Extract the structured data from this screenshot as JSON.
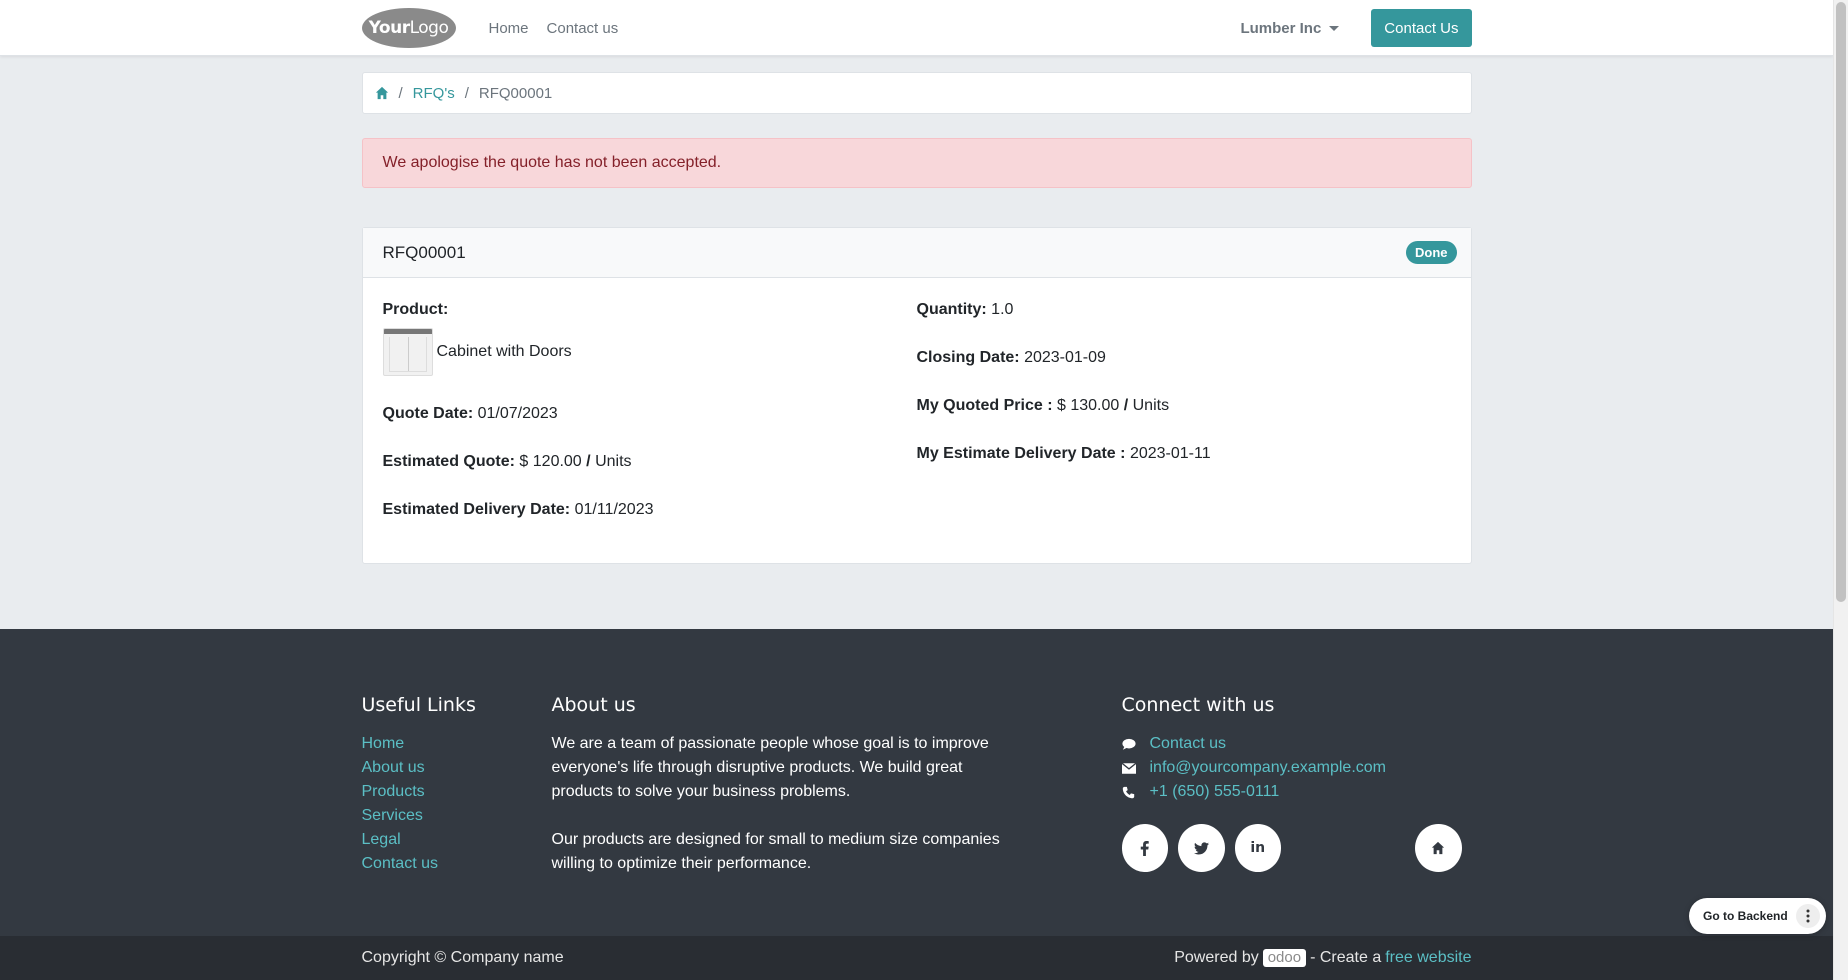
{
  "header": {
    "logo_text_bold": "Your",
    "logo_text": "Logo",
    "nav": [
      "Home",
      "Contact us"
    ],
    "company": "Lumber Inc",
    "contact_button": "Contact Us"
  },
  "breadcrumb": {
    "home_icon": "home-icon",
    "link": "RFQ's",
    "current": "RFQ00001",
    "sep": "/"
  },
  "alert": {
    "message": "We apologise the quote has not been accepted."
  },
  "card": {
    "title": "RFQ00001",
    "status": "Done",
    "left": {
      "product_label": "Product:",
      "product_name": "Cabinet with Doors",
      "quote_date_label": "Quote Date:",
      "quote_date": "01/07/2023",
      "estimated_quote_label": "Estimated Quote:",
      "estimated_quote": "$ 120.00",
      "estimated_quote_unit": "Units",
      "estimated_delivery_label": "Estimated Delivery Date:",
      "estimated_delivery": "01/11/2023"
    },
    "right": {
      "quantity_label": "Quantity:",
      "quantity": "1.0",
      "closing_date_label": "Closing Date:",
      "closing_date": "2023-01-09",
      "quoted_price_label": "My Quoted Price :",
      "quoted_price": "$ 130.00",
      "quoted_price_unit": "Units",
      "estimate_delivery_label": "My Estimate Delivery Date :",
      "estimate_delivery": "2023-01-11"
    },
    "slash": "/"
  },
  "footer": {
    "useful_links_title": "Useful Links",
    "useful_links": [
      "Home",
      "About us",
      "Products",
      "Services",
      "Legal",
      "Contact us"
    ],
    "about_title": "About us",
    "about_p1": "We are a team of passionate people whose goal is to improve everyone's life through disruptive products. We build great products to solve your business problems.",
    "about_p2": "Our products are designed for small to medium size companies willing to optimize their performance.",
    "connect_title": "Connect with us",
    "connect_contact": "Contact us",
    "connect_email": "info@yourcompany.example.com",
    "connect_phone": "+1 (650) 555-0111",
    "social_icons": [
      "facebook-icon",
      "twitter-icon",
      "linkedin-icon",
      "home-icon"
    ]
  },
  "copyright": {
    "text": "Copyright © Company name",
    "powered_by": "Powered by",
    "odoo": "odoo",
    "create": "- Create a",
    "free_website": "free website"
  },
  "backend": {
    "label": "Go to Backend"
  },
  "colors": {
    "primary": "#35979c",
    "alert_bg": "#f8d7da",
    "alert_text": "#842029",
    "footer_bg": "#333941",
    "link_footer": "#5bbfc5"
  }
}
